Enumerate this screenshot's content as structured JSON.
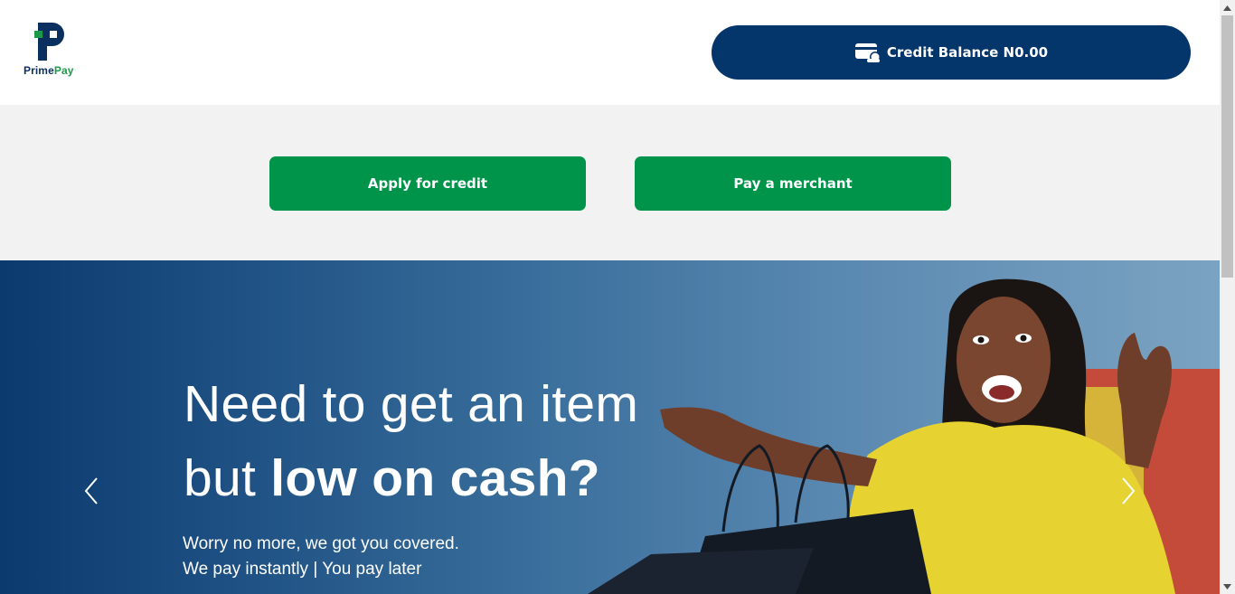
{
  "header": {
    "logo": {
      "text_primary": "Prime",
      "text_accent": "Pay",
      "colors": {
        "primary": "#0b2f5e",
        "accent": "#1a9a48"
      }
    },
    "balance_button": {
      "icon": "wallet-icon",
      "label": "Credit Balance N0.00",
      "color": "#04356b"
    }
  },
  "actions": {
    "apply_label": "Apply for credit",
    "pay_label": "Pay a merchant",
    "color": "#00944a"
  },
  "hero": {
    "headline_line1": "Need to get an item",
    "headline_line2_regular": "but ",
    "headline_line2_bold": "low on cash?",
    "subline_1": "Worry no more, we got you covered.",
    "subline_2": "We pay instantly | You pay later",
    "prev_icon": "chevron-left-icon",
    "next_icon": "chevron-right-icon"
  },
  "scrollbar": {
    "up_icon": "scroll-up-arrow-icon",
    "down_icon": "scroll-down-arrow-icon"
  }
}
